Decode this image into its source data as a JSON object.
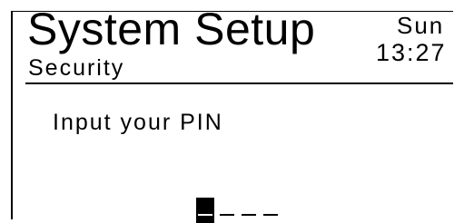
{
  "header": {
    "title": "System Setup",
    "subtitle": "Security",
    "day": "Sun",
    "time": "13:27"
  },
  "main": {
    "prompt": "Input your PIN",
    "pin": {
      "length": 4,
      "entered_digits": 0,
      "cursor_index": 0,
      "slots": [
        "",
        "",
        "",
        ""
      ]
    }
  },
  "colors": {
    "foreground": "#000000",
    "background": "#ffffff"
  }
}
